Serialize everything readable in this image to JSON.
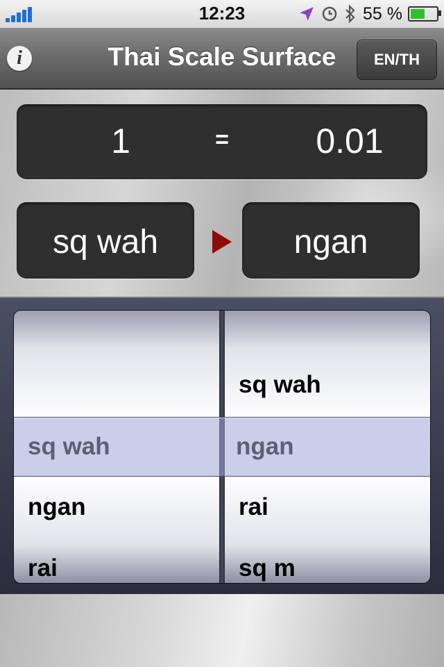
{
  "status_bar": {
    "time": "12:23",
    "battery_percent_label": "55 %",
    "battery_level": 0.55,
    "icons": [
      "signal-icon",
      "location-arrow-icon",
      "alarm-clock-icon",
      "bluetooth-icon",
      "battery-icon"
    ]
  },
  "nav": {
    "title": "Thai Scale Surface",
    "info_icon": "info-icon",
    "language_button": "EN/TH"
  },
  "conversion": {
    "input_value": "1",
    "equals": "=",
    "output_value": "0.01",
    "from_unit": "sq wah",
    "to_unit": "ngan",
    "arrow_icon": "play-arrow-icon",
    "arrow_color": "#8e0b0b"
  },
  "picker": {
    "left_column": {
      "above": [
        "",
        ""
      ],
      "selected": "sq wah",
      "below": [
        "ngan",
        "rai"
      ]
    },
    "right_column": {
      "above": [
        "",
        "sq wah"
      ],
      "selected": "ngan",
      "below": [
        "rai",
        "sq m"
      ]
    }
  }
}
